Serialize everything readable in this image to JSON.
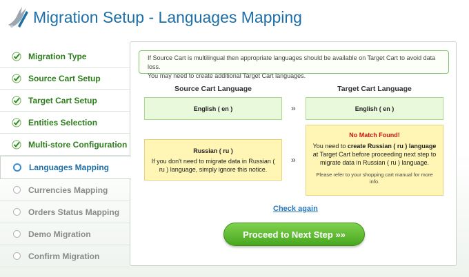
{
  "header": {
    "title": "Migration Setup - Languages Mapping"
  },
  "sidebar": {
    "steps": [
      {
        "label": "Migration Type",
        "state": "done"
      },
      {
        "label": "Source Cart Setup",
        "state": "done"
      },
      {
        "label": "Target Cart Setup",
        "state": "done"
      },
      {
        "label": "Entities Selection",
        "state": "done"
      },
      {
        "label": "Multi-store Configuration",
        "state": "done"
      },
      {
        "label": "Languages Mapping",
        "state": "active"
      },
      {
        "label": "Currencies Mapping",
        "state": "todo"
      },
      {
        "label": "Orders Status Mapping",
        "state": "todo"
      },
      {
        "label": "Demo Migration",
        "state": "todo"
      },
      {
        "label": "Confirm Migration",
        "state": "todo"
      }
    ]
  },
  "notice": {
    "line1": "If Source Cart is multilingual then appropriate languages should be available on Target Cart to avoid data loss.",
    "line2": "You may need to create additional Target Cart languages."
  },
  "mapping": {
    "source_header": "Source Cart Language",
    "target_header": "Target Cart Language",
    "arrow": "»",
    "rows": [
      {
        "source": "English ( en )",
        "target": "English ( en )"
      },
      {
        "source": "Russian ( ru )",
        "source_note": "If you don't need to migrate data in Russian ( ru ) language, simply ignore this notice.",
        "target_title": "No Match Found!",
        "target_pre": "You need to ",
        "target_bold": "create Russian ( ru ) language",
        "target_post": " at Target Cart before proceeding next step to migrate data in Russian ( ru ) language.",
        "target_hint": "Please refer to your shopping cart manual for more info."
      }
    ]
  },
  "actions": {
    "check_again": "Check again",
    "proceed": "Proceed to Next Step »»"
  },
  "colors": {
    "title_blue": "#1d6fa8",
    "done_green": "#2e7d1c",
    "error_red": "#cc1111",
    "button_green": "#5bb82c"
  }
}
